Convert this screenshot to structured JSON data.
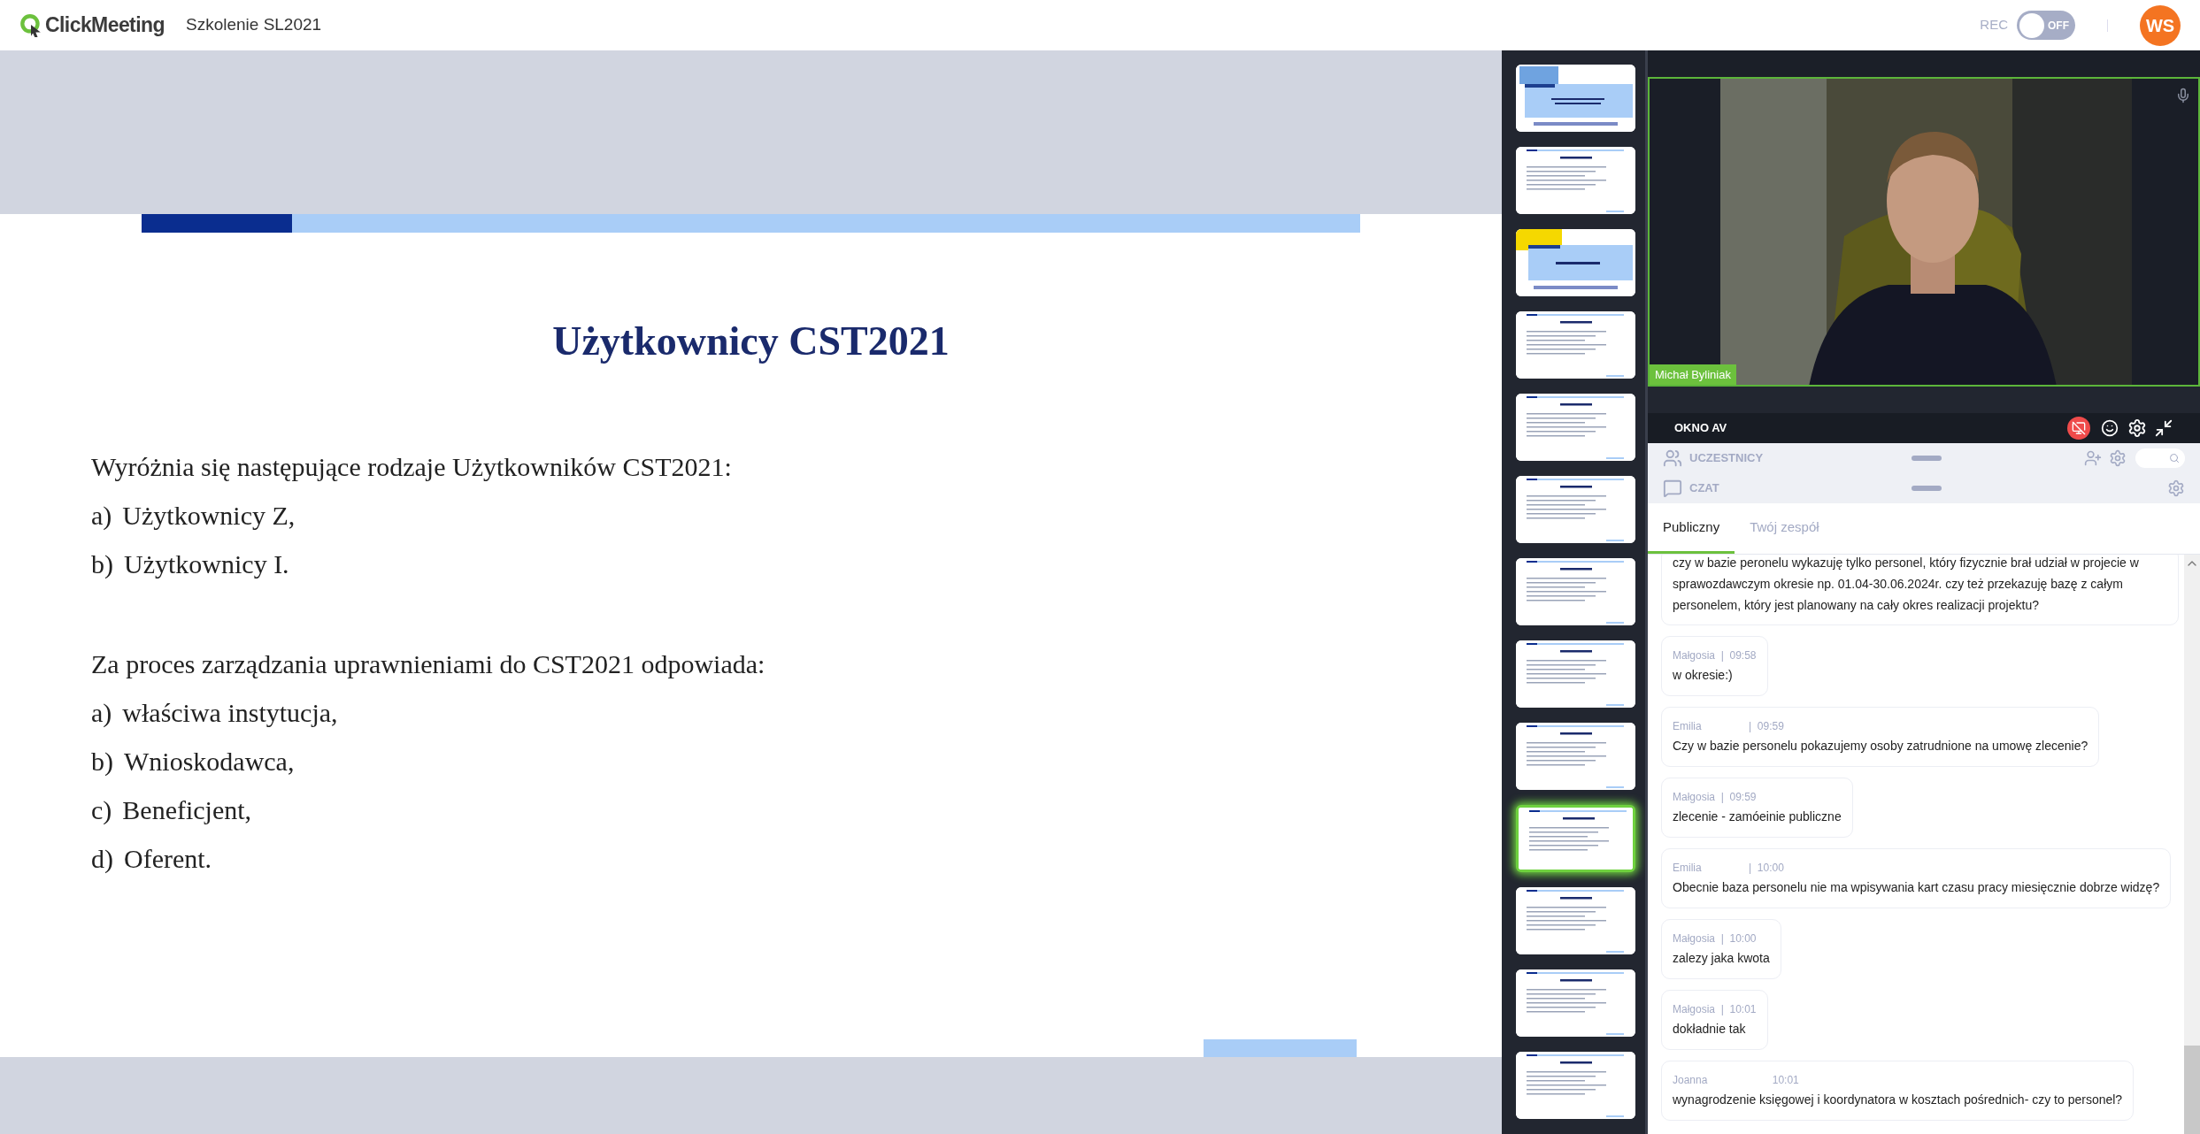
{
  "header": {
    "logo": "ClickMeeting",
    "meeting_title": "Szkolenie SL2021",
    "rec": {
      "label": "REC",
      "on": false,
      "state_text": "OFF"
    },
    "avatar": "WS"
  },
  "slide": {
    "title": "Użytkownicy CST2021",
    "sections": [
      {
        "intro": "Wyróżnia się następujące rodzaje Użytkowników CST2021:",
        "items": [
          {
            "marker": "a)",
            "text": "Użytkownicy Z,"
          },
          {
            "marker": "b)",
            "text": "Użytkownicy I."
          }
        ]
      },
      {
        "intro": "Za proces zarządzania uprawnieniami do CST2021 odpowiada:",
        "items": [
          {
            "marker": "a)",
            "text": "właściwa instytucja,"
          },
          {
            "marker": "b)",
            "text": "Wnioskodawca,"
          },
          {
            "marker": "c)",
            "text": "Beneficjent,"
          },
          {
            "marker": "d)",
            "text": "Oferent."
          }
        ]
      }
    ]
  },
  "thumbnails": [
    {
      "kind": "title",
      "selected": false
    },
    {
      "kind": "content",
      "selected": false
    },
    {
      "kind": "section",
      "selected": false
    },
    {
      "kind": "content",
      "selected": false
    },
    {
      "kind": "content",
      "selected": false
    },
    {
      "kind": "content",
      "selected": false
    },
    {
      "kind": "content",
      "selected": false
    },
    {
      "kind": "content",
      "selected": false
    },
    {
      "kind": "content",
      "selected": false
    },
    {
      "kind": "content",
      "selected": true
    },
    {
      "kind": "content",
      "selected": false
    },
    {
      "kind": "content",
      "selected": false
    },
    {
      "kind": "content",
      "selected": false
    }
  ],
  "video": {
    "kind": "picture",
    "name": "Michał Byliniak"
  },
  "av_panel": {
    "title": "OKNO AV"
  },
  "participants": {
    "title": "UCZESTNICY"
  },
  "chat": {
    "title": "CZAT",
    "tabs": [
      {
        "label": "Publiczny",
        "selected": true
      },
      {
        "label": "Twój zespół",
        "selected": false
      }
    ],
    "messages": [
      {
        "text": "czy w bazie peronelu wykazuję tylko personel, który fizycznie brał udział w projecie w sprawozdawczym okresie np. 01.04-30.06.2024r. czy też przekazuję bazę z całym personelem, który jest planowany na cały okres realizacji projektu?"
      },
      {
        "meta": "Małgosia  |  09:58",
        "text": "w okresie:)"
      },
      {
        "meta": "Emilia                |  09:59",
        "text": "Czy w bazie personelu pokazujemy osoby zatrudnione na umowę zlecenie?"
      },
      {
        "meta": "Małgosia  |  09:59",
        "text": "zlecenie - zamóeinie  publiczne"
      },
      {
        "meta": "Emilia                |  10:00",
        "text": "Obecnie baza personelu nie ma wpisywania kart czasu pracy miesięcznie dobrze widzę?"
      },
      {
        "meta": "Małgosia  |  10:00",
        "text": "zalezy  jaka kwota"
      },
      {
        "meta": "Małgosia  |  10:01",
        "text": "dokładnie   tak"
      },
      {
        "meta": "Joanna                      10:01",
        "text": "wynagrodzenie księgowej i koordynatora w kosztach pośrednich- czy to personel?"
      }
    ]
  }
}
